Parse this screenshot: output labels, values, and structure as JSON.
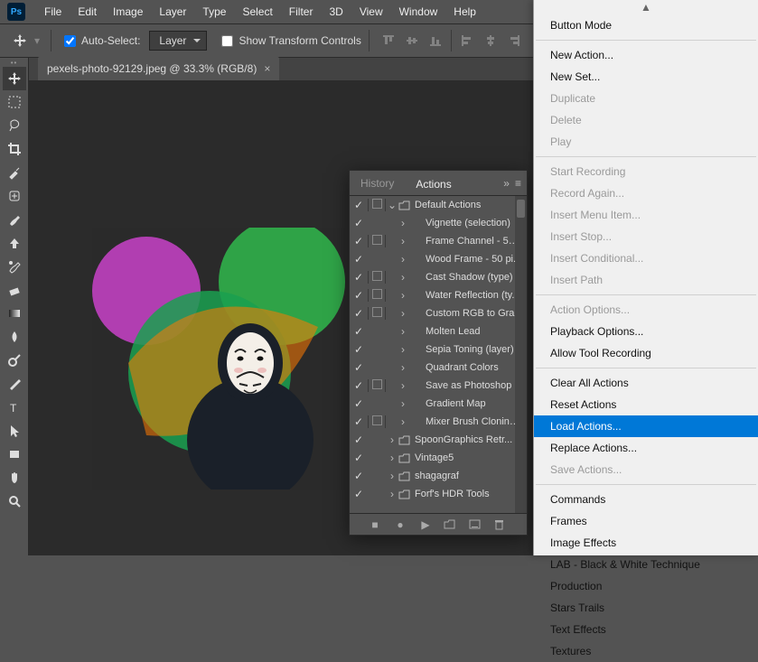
{
  "menubar": {
    "items": [
      "File",
      "Edit",
      "Image",
      "Layer",
      "Type",
      "Select",
      "Filter",
      "3D",
      "View",
      "Window",
      "Help"
    ]
  },
  "optionsbar": {
    "auto_select_label": "Auto-Select:",
    "layer_dropdown": "Layer",
    "show_transform_label": "Show Transform Controls"
  },
  "document": {
    "tab_title": "pexels-photo-92129.jpeg @ 33.3% (RGB/8)"
  },
  "actions_panel": {
    "tabs": {
      "history": "History",
      "actions": "Actions"
    },
    "rows": [
      {
        "checked": true,
        "mode": true,
        "expand": "down",
        "folder": true,
        "label": "Default Actions",
        "level": 0
      },
      {
        "checked": true,
        "mode": false,
        "expand": "right",
        "folder": false,
        "label": "Vignette (selection)",
        "level": 1
      },
      {
        "checked": true,
        "mode": true,
        "expand": "right",
        "folder": false,
        "label": "Frame Channel - 50 ...",
        "level": 1
      },
      {
        "checked": true,
        "mode": false,
        "expand": "right",
        "folder": false,
        "label": "Wood Frame - 50 pi...",
        "level": 1
      },
      {
        "checked": true,
        "mode": true,
        "expand": "right",
        "folder": false,
        "label": "Cast Shadow (type)",
        "level": 1
      },
      {
        "checked": true,
        "mode": true,
        "expand": "right",
        "folder": false,
        "label": "Water Reflection (ty...",
        "level": 1
      },
      {
        "checked": true,
        "mode": true,
        "expand": "right",
        "folder": false,
        "label": "Custom RGB to Gra...",
        "level": 1
      },
      {
        "checked": true,
        "mode": false,
        "expand": "right",
        "folder": false,
        "label": "Molten Lead",
        "level": 1
      },
      {
        "checked": true,
        "mode": false,
        "expand": "right",
        "folder": false,
        "label": "Sepia Toning (layer)",
        "level": 1
      },
      {
        "checked": true,
        "mode": false,
        "expand": "right",
        "folder": false,
        "label": "Quadrant Colors",
        "level": 1
      },
      {
        "checked": true,
        "mode": true,
        "expand": "right",
        "folder": false,
        "label": "Save as Photoshop ...",
        "level": 1
      },
      {
        "checked": true,
        "mode": false,
        "expand": "right",
        "folder": false,
        "label": "Gradient Map",
        "level": 1
      },
      {
        "checked": true,
        "mode": true,
        "expand": "right",
        "folder": false,
        "label": "Mixer Brush Cloning...",
        "level": 1
      },
      {
        "checked": true,
        "mode": false,
        "expand": "right",
        "folder": true,
        "label": "SpoonGraphics Retr...",
        "level": 0
      },
      {
        "checked": true,
        "mode": false,
        "expand": "right",
        "folder": true,
        "label": "Vintage5",
        "level": 0
      },
      {
        "checked": true,
        "mode": false,
        "expand": "right",
        "folder": true,
        "label": "shagagraf",
        "level": 0
      },
      {
        "checked": true,
        "mode": false,
        "expand": "right",
        "folder": true,
        "label": "Forf's HDR Tools",
        "level": 0
      }
    ]
  },
  "flyout": {
    "groups": [
      [
        {
          "label": "Button Mode",
          "enabled": true
        }
      ],
      [
        {
          "label": "New Action...",
          "enabled": true
        },
        {
          "label": "New Set...",
          "enabled": true
        },
        {
          "label": "Duplicate",
          "enabled": false
        },
        {
          "label": "Delete",
          "enabled": false
        },
        {
          "label": "Play",
          "enabled": false
        }
      ],
      [
        {
          "label": "Start Recording",
          "enabled": false
        },
        {
          "label": "Record Again...",
          "enabled": false
        },
        {
          "label": "Insert Menu Item...",
          "enabled": false
        },
        {
          "label": "Insert Stop...",
          "enabled": false
        },
        {
          "label": "Insert Conditional...",
          "enabled": false
        },
        {
          "label": "Insert Path",
          "enabled": false
        }
      ],
      [
        {
          "label": "Action Options...",
          "enabled": false
        },
        {
          "label": "Playback Options...",
          "enabled": true
        },
        {
          "label": "Allow Tool Recording",
          "enabled": true
        }
      ],
      [
        {
          "label": "Clear All Actions",
          "enabled": true
        },
        {
          "label": "Reset Actions",
          "enabled": true
        },
        {
          "label": "Load Actions...",
          "enabled": true,
          "highlight": true
        },
        {
          "label": "Replace Actions...",
          "enabled": true
        },
        {
          "label": "Save Actions...",
          "enabled": false
        }
      ],
      [
        {
          "label": "Commands",
          "enabled": true
        },
        {
          "label": "Frames",
          "enabled": true
        },
        {
          "label": "Image Effects",
          "enabled": true
        },
        {
          "label": "LAB - Black & White Technique",
          "enabled": true
        },
        {
          "label": "Production",
          "enabled": true
        },
        {
          "label": "Stars Trails",
          "enabled": true
        },
        {
          "label": "Text Effects",
          "enabled": true
        },
        {
          "label": "Textures",
          "enabled": true
        }
      ]
    ]
  },
  "toolbox": {
    "tools": [
      "move",
      "marquee",
      "lasso",
      "crop",
      "eyedropper",
      "healing",
      "brush",
      "clone",
      "history-brush",
      "eraser",
      "gradient",
      "blur",
      "dodge",
      "pen",
      "type",
      "path-select",
      "rectangle",
      "hand",
      "zoom"
    ]
  }
}
